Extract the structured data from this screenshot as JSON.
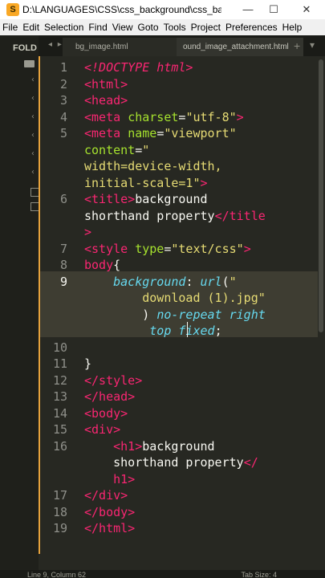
{
  "window": {
    "title": "D:\\LANGUAGES\\CSS\\css_background\\css_backgrou...",
    "app_icon": "S",
    "min_glyph": "—",
    "max_glyph": "☐",
    "close_glyph": "✕"
  },
  "menu": [
    "File",
    "Edit",
    "Selection",
    "Find",
    "View",
    "Goto",
    "Tools",
    "Project",
    "Preferences",
    "Help"
  ],
  "sidebar": {
    "header": "FOLD"
  },
  "tabs": {
    "nav_glyph": "◂ ▸",
    "items": [
      "bg_image.html",
      "ound_image_attachment.html"
    ],
    "add_glyph": "+",
    "menu_glyph": "▾"
  },
  "editor": {
    "line_numbers": [
      "1",
      "2",
      "3",
      "4",
      "5",
      "",
      "",
      "",
      "6",
      "",
      "",
      "7",
      "8",
      "9",
      "",
      "",
      "",
      "10",
      "11",
      "12",
      "13",
      "14",
      "15",
      "16",
      "",
      "",
      "17",
      "18",
      "19"
    ],
    "active_line": "9"
  },
  "status": {
    "position": "Line 9, Column 62",
    "tab_size": "Tab Size: 4"
  },
  "colors": {
    "tag": "#f92672",
    "attr": "#a6e22e",
    "string": "#e6db74",
    "keyword": "#66d9ef",
    "background": "#272822"
  }
}
